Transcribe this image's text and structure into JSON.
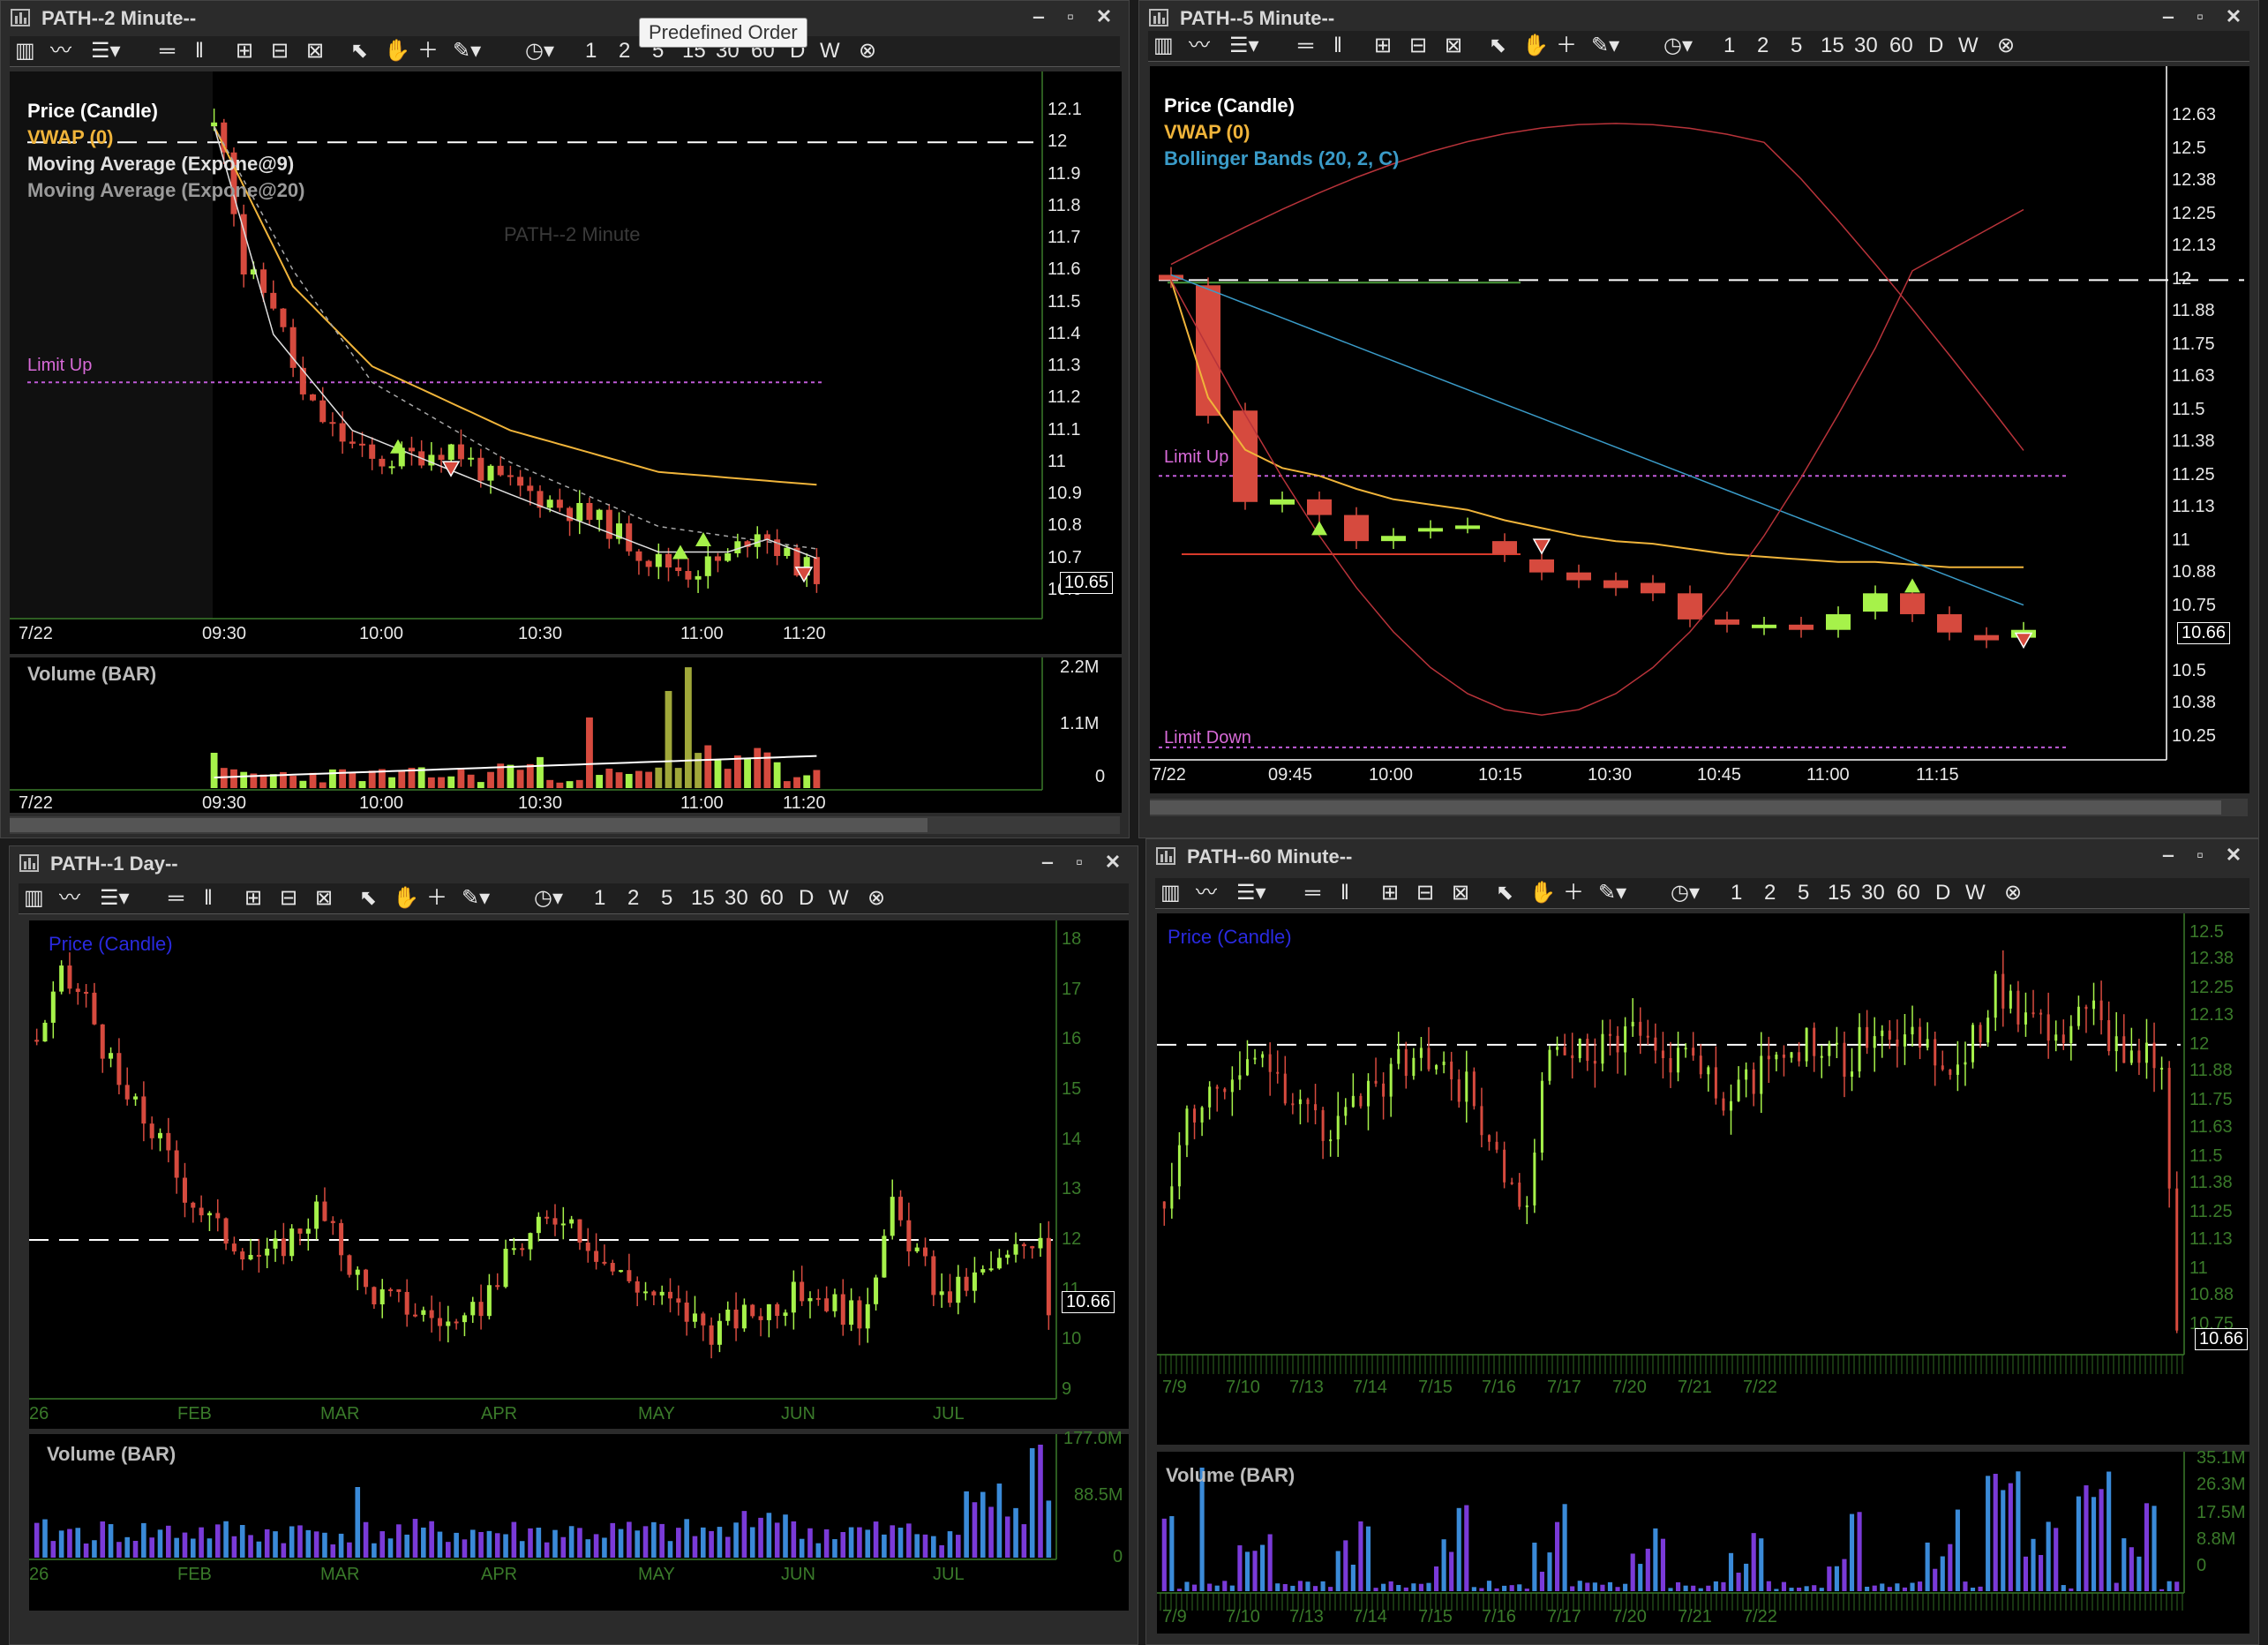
{
  "tooltip": "Predefined Order",
  "toolbar": {
    "i1": "1",
    "i2": "2",
    "i5": "5",
    "i15": "15",
    "i30": "30",
    "i60": "60",
    "d": "D",
    "w": "W"
  },
  "win_tl": {
    "title": "PATH--2 Minute--",
    "watermark": "PATH--2 Minute",
    "legend": [
      "Price (Candle)",
      "VWAP (0)",
      "Moving Average (Expone@9)",
      "Moving Average (Expone@20)"
    ],
    "limit_up": "Limit Up",
    "y_ticks": [
      "12.1",
      "12",
      "11.9",
      "11.8",
      "11.7",
      "11.6",
      "11.5",
      "11.4",
      "11.3",
      "11.2",
      "11.1",
      "11",
      "10.9",
      "10.8",
      "10.7",
      "10.6"
    ],
    "price_tag": "10.65",
    "x_ticks": [
      "7/22",
      "09:30",
      "10:00",
      "10:30",
      "11:00",
      "11:20"
    ],
    "vol_label": "Volume (BAR)",
    "vol_ticks": [
      "2.2M",
      "1.1M",
      "0"
    ]
  },
  "win_tr": {
    "title": "PATH--5 Minute--",
    "legend": [
      "Price (Candle)",
      "VWAP (0)",
      "Bollinger Bands (20, 2, C)"
    ],
    "limit_up": "Limit Up",
    "limit_down": "Limit Down",
    "y_ticks": [
      "12.63",
      "12.5",
      "12.38",
      "12.25",
      "12.13",
      "12",
      "11.88",
      "11.75",
      "11.63",
      "11.5",
      "11.38",
      "11.25",
      "11.13",
      "11",
      "10.88",
      "10.75",
      "10.5",
      "10.38",
      "10.25"
    ],
    "price_tag": "10.66",
    "x_ticks": [
      "7/22",
      "09:45",
      "10:00",
      "10:15",
      "10:30",
      "10:45",
      "11:00",
      "11:15"
    ]
  },
  "win_bl": {
    "title": "PATH--1 Day--",
    "legend": "Price (Candle)",
    "y_ticks": [
      "18",
      "17",
      "16",
      "15",
      "14",
      "13",
      "12",
      "11",
      "10",
      "9"
    ],
    "price_tag": "10.66",
    "x_ticks": [
      "26",
      "FEB",
      "MAR",
      "APR",
      "MAY",
      "JUN",
      "JUL"
    ],
    "vol_label": "Volume (BAR)",
    "vol_ticks": [
      "177.0M",
      "88.5M",
      "0"
    ]
  },
  "win_br": {
    "title": "PATH--60 Minute--",
    "legend": "Price (Candle)",
    "y_ticks": [
      "12.5",
      "12.38",
      "12.25",
      "12.13",
      "12",
      "11.88",
      "11.75",
      "11.63",
      "11.5",
      "11.38",
      "11.25",
      "11.13",
      "11",
      "10.88",
      "10.75"
    ],
    "price_tag": "10.66",
    "x_ticks": [
      "7/9",
      "7/10",
      "7/13",
      "7/14",
      "7/15",
      "7/16",
      "7/17",
      "7/20",
      "7/21",
      "7/22"
    ],
    "vol_label": "Volume (BAR)",
    "vol_ticks": [
      "35.1M",
      "26.3M",
      "17.5M",
      "8.8M",
      "0"
    ]
  },
  "colors": {
    "up": "#a6f24a",
    "down": "#d64a3e",
    "vwap": "#f0b43a",
    "ma9": "#e0e0e0",
    "ma20": "#a8a8a8",
    "bb_mid": "#3a9bc8",
    "bb_band": "#b8333a",
    "limit": "#c05bd8",
    "axis_green": "#3a7a2a"
  }
}
